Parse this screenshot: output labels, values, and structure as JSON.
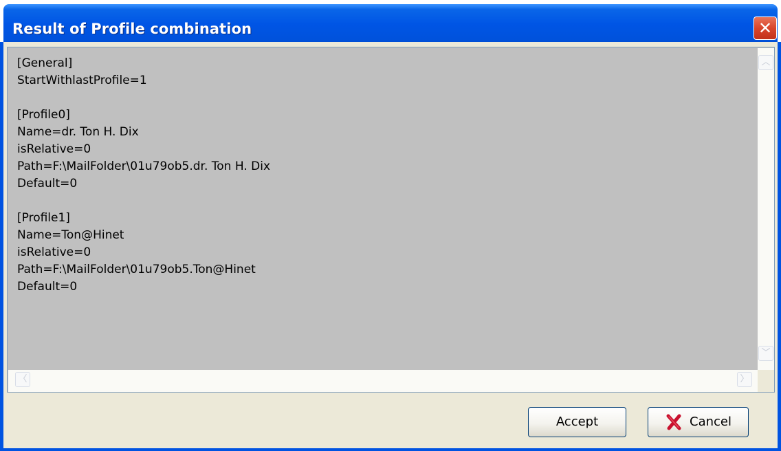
{
  "window": {
    "title": "Result of Profile combination",
    "close_glyph": "✕"
  },
  "content": {
    "lines": [
      "[General]",
      "StartWithlastProfile=1",
      "",
      "[Profile0]",
      "Name=dr. Ton H. Dix",
      "isRelative=0",
      "Path=F:\\MailFolder\\01u79ob5.dr. Ton H. Dix",
      "Default=0",
      "",
      "[Profile1]",
      "Name=Ton@Hinet",
      "isRelative=0",
      "Path=F:\\MailFolder\\01u79ob5.Ton@Hinet",
      "Default=0"
    ]
  },
  "buttons": {
    "accept_label": "Accept",
    "cancel_label": "Cancel",
    "cancel_icon": "red-x-icon"
  },
  "scrollbars": {
    "up_arrow": "︿",
    "down_arrow": "﹀",
    "left_arrow": "〈",
    "right_arrow": "〉"
  },
  "colors": {
    "titlebar_blue": "#0055e5",
    "editor_background": "#c0c0c0",
    "dialog_background": "#ece9d8",
    "close_red": "#d9452b",
    "cancel_icon_red": "#c8102e"
  }
}
